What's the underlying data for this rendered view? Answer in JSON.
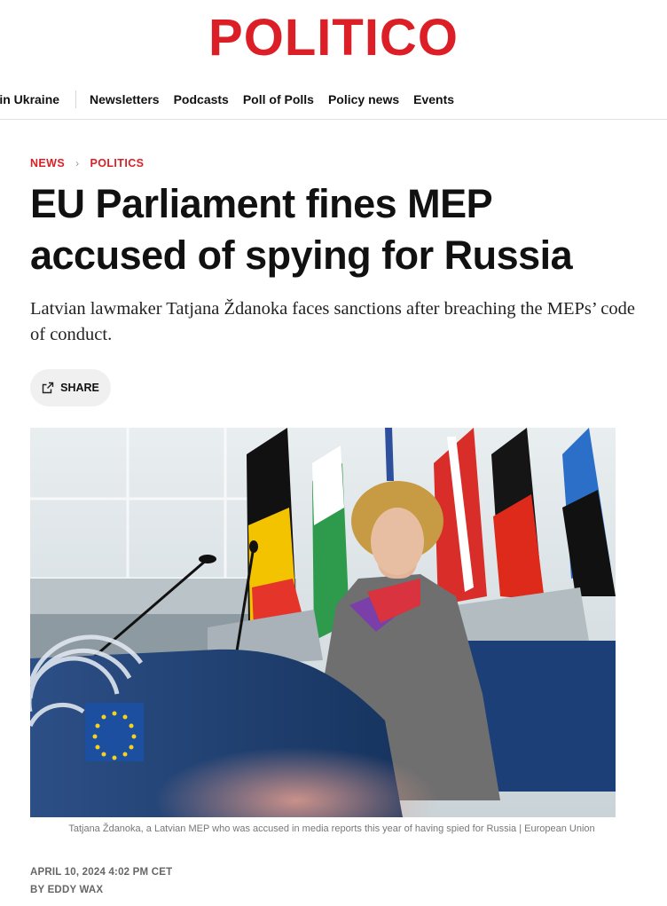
{
  "brand": {
    "logo_text": "POLITICO",
    "accent_color": "#dc1f26"
  },
  "nav": {
    "first_item": "r in Ukraine",
    "items": [
      "Newsletters",
      "Podcasts",
      "Poll of Polls",
      "Policy news",
      "Events"
    ]
  },
  "breadcrumb": {
    "section": "NEWS",
    "subsection": "POLITICS"
  },
  "article": {
    "headline": "EU Parliament fines MEP accused of spying for Russia",
    "dek": "Latvian lawmaker Tatjana Ždanoka faces sanctions after breaching the MEPs’ code of conduct.",
    "share_label": "SHARE",
    "image": {
      "caption": "Tatjana Ždanoka, a Latvian MEP who was accused in media reports this year of having spied for Russia | European Union"
    },
    "date": "APRIL 10, 2024 4:02 PM CET",
    "byline": "BY EDDY WAX"
  },
  "icons": {
    "share": "share-external-icon",
    "breadcrumb_separator": "chevron-right-icon"
  }
}
